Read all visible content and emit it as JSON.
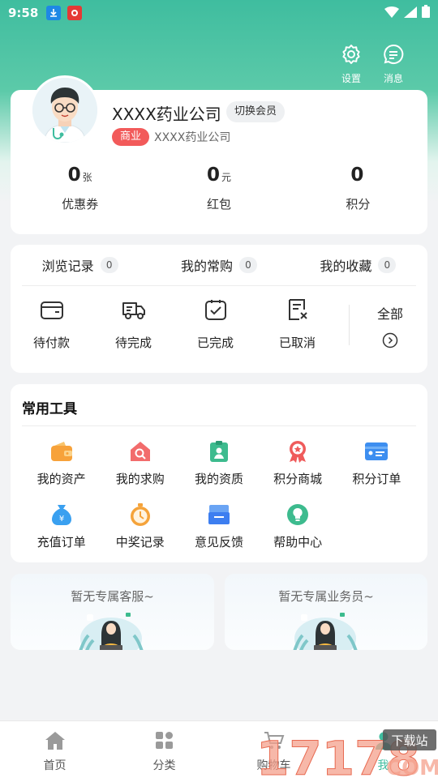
{
  "status_bar": {
    "time": "9:58"
  },
  "header": {
    "settings_label": "设置",
    "messages_label": "消息"
  },
  "profile": {
    "company_name": "XXXX药业公司",
    "switch_label": "切换会员",
    "badge": "商业",
    "sub_name": "XXXX药业公司",
    "stats": [
      {
        "value": "0",
        "unit": "张",
        "label": "优惠券"
      },
      {
        "value": "0",
        "unit": "元",
        "label": "红包"
      },
      {
        "value": "0",
        "unit": "",
        "label": "积分"
      }
    ]
  },
  "orders": {
    "tabs": [
      {
        "label": "浏览记录",
        "count": "0"
      },
      {
        "label": "我的常购",
        "count": "0"
      },
      {
        "label": "我的收藏",
        "count": "0"
      }
    ],
    "statuses": [
      {
        "label": "待付款",
        "icon": "wallet-icon"
      },
      {
        "label": "待完成",
        "icon": "delivery-truck-icon"
      },
      {
        "label": "已完成",
        "icon": "completed-check-icon"
      },
      {
        "label": "已取消",
        "icon": "cancelled-doc-icon"
      }
    ],
    "all_label": "全部"
  },
  "tools": {
    "title": "常用工具",
    "items": [
      {
        "label": "我的资产",
        "icon": "assets-wallet-icon",
        "color": "#f7a23a"
      },
      {
        "label": "我的求购",
        "icon": "search-house-icon",
        "color": "#f26c6c"
      },
      {
        "label": "我的资质",
        "icon": "qualification-badge-icon",
        "color": "#3dbb8e"
      },
      {
        "label": "积分商城",
        "icon": "medal-icon",
        "color": "#ef5b5b"
      },
      {
        "label": "积分订单",
        "icon": "id-card-icon",
        "color": "#3d8ef0"
      },
      {
        "label": "充值订单",
        "icon": "money-bag-icon",
        "color": "#3aa0f0"
      },
      {
        "label": "中奖记录",
        "icon": "prize-clock-icon",
        "color": "#f5a33a"
      },
      {
        "label": "意见反馈",
        "icon": "feedback-box-icon",
        "color": "#3d7ef0"
      },
      {
        "label": "帮助中心",
        "icon": "lightbulb-icon",
        "color": "#3dbb8e"
      }
    ]
  },
  "service": {
    "no_customer_service": "暂无专属客服~",
    "no_salesperson": "暂无专属业务员~"
  },
  "bottom_nav": [
    {
      "label": "首页",
      "icon": "home-icon"
    },
    {
      "label": "分类",
      "icon": "category-grid-icon"
    },
    {
      "label": "购物车",
      "icon": "cart-icon"
    },
    {
      "label": "我",
      "icon": "user-icon"
    }
  ],
  "watermark": {
    "text": "17178",
    "sub": "下载站",
    "suffix": "COM"
  },
  "colors": {
    "primary": "#3fbd9f",
    "badge_red": "#f25a5a"
  }
}
